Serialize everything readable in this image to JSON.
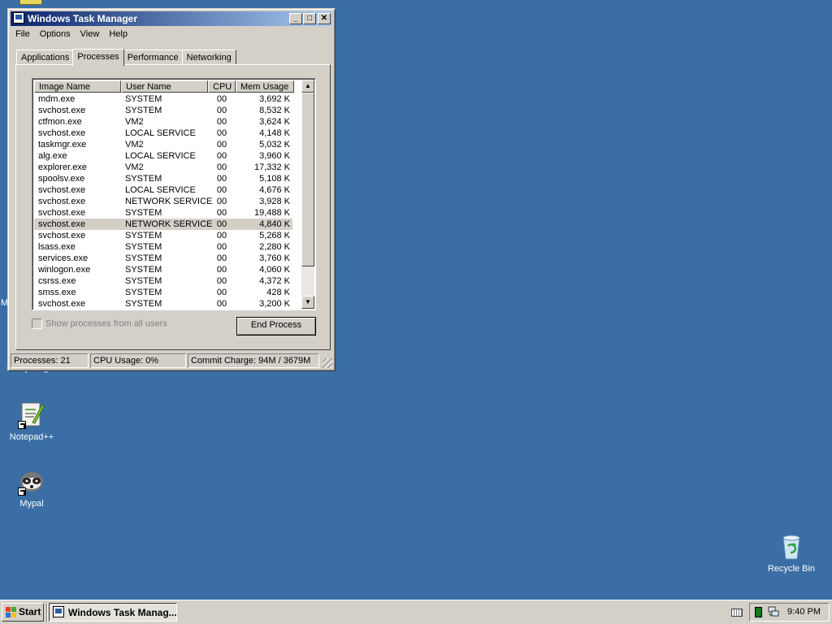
{
  "desktop": {
    "stub_m": "M",
    "stub_label": "Everything",
    "icons": [
      {
        "label": "Notepad++"
      },
      {
        "label": "Mypal"
      },
      {
        "label": "Recycle Bin"
      }
    ]
  },
  "window": {
    "title": "Windows Task Manager",
    "controls": {
      "minimize": "_",
      "maximize": "□",
      "close": "✕"
    },
    "menu": [
      "File",
      "Options",
      "View",
      "Help"
    ],
    "tabs": [
      "Applications",
      "Processes",
      "Performance",
      "Networking"
    ],
    "active_tab": "Processes",
    "columns": [
      "Image Name",
      "User Name",
      "CPU",
      "Mem Usage"
    ],
    "processes": [
      {
        "image": "mdm.exe",
        "user": "SYSTEM",
        "cpu": "00",
        "mem": "3,692 K"
      },
      {
        "image": "svchost.exe",
        "user": "SYSTEM",
        "cpu": "00",
        "mem": "8,532 K"
      },
      {
        "image": "ctfmon.exe",
        "user": "VM2",
        "cpu": "00",
        "mem": "3,624 K"
      },
      {
        "image": "svchost.exe",
        "user": "LOCAL SERVICE",
        "cpu": "00",
        "mem": "4,148 K"
      },
      {
        "image": "taskmgr.exe",
        "user": "VM2",
        "cpu": "00",
        "mem": "5,032 K"
      },
      {
        "image": "alg.exe",
        "user": "LOCAL SERVICE",
        "cpu": "00",
        "mem": "3,960 K"
      },
      {
        "image": "explorer.exe",
        "user": "VM2",
        "cpu": "00",
        "mem": "17,332 K"
      },
      {
        "image": "spoolsv.exe",
        "user": "SYSTEM",
        "cpu": "00",
        "mem": "5,108 K"
      },
      {
        "image": "svchost.exe",
        "user": "LOCAL SERVICE",
        "cpu": "00",
        "mem": "4,676 K"
      },
      {
        "image": "svchost.exe",
        "user": "NETWORK SERVICE",
        "cpu": "00",
        "mem": "3,928 K"
      },
      {
        "image": "svchost.exe",
        "user": "SYSTEM",
        "cpu": "00",
        "mem": "19,488 K"
      },
      {
        "image": "svchost.exe",
        "user": "NETWORK SERVICE",
        "cpu": "00",
        "mem": "4,840 K",
        "selected": true
      },
      {
        "image": "svchost.exe",
        "user": "SYSTEM",
        "cpu": "00",
        "mem": "5,268 K"
      },
      {
        "image": "lsass.exe",
        "user": "SYSTEM",
        "cpu": "00",
        "mem": "2,280 K"
      },
      {
        "image": "services.exe",
        "user": "SYSTEM",
        "cpu": "00",
        "mem": "3,760 K"
      },
      {
        "image": "winlogon.exe",
        "user": "SYSTEM",
        "cpu": "00",
        "mem": "4,060 K"
      },
      {
        "image": "csrss.exe",
        "user": "SYSTEM",
        "cpu": "00",
        "mem": "4,372 K"
      },
      {
        "image": "smss.exe",
        "user": "SYSTEM",
        "cpu": "00",
        "mem": "428 K"
      },
      {
        "image": "svchost.exe",
        "user": "SYSTEM",
        "cpu": "00",
        "mem": "3,200 K"
      }
    ],
    "show_all_label": "Show processes from all users",
    "show_all_checked": false,
    "end_process_label": "End Process",
    "status": {
      "processes": "Processes: 21",
      "cpu": "CPU Usage: 0%",
      "commit": "Commit Charge: 94M / 3679M"
    }
  },
  "taskbar": {
    "start_label": "Start",
    "task_label": "Windows Task Manag...",
    "clock": "9:40 PM"
  },
  "icons": {
    "app": "task-manager-icon",
    "notepad": "notepad-plus-plus-icon",
    "mypal": "mypal-icon",
    "recycle": "recycle-bin-icon",
    "start": "windows-flag-icon",
    "keyboard": "keyboard-icon",
    "tray_cpu": "cpu-meter-icon",
    "tray_net": "network-icon"
  },
  "colors": {
    "desktop": "#3a6ea5",
    "title_start": "#0a246a",
    "title_end": "#a6caf0",
    "face": "#d4d0c8"
  }
}
